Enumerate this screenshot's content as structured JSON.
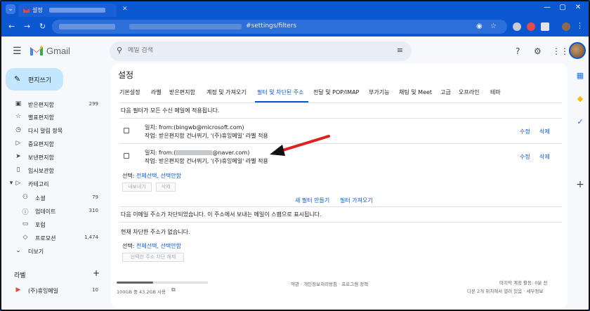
{
  "browser": {
    "tab_title": "설정",
    "url_visible": "#settings/filters"
  },
  "header": {
    "app_name": "Gmail",
    "search_placeholder": "메일 검색"
  },
  "sidebar": {
    "compose_label": "편지쓰기",
    "items": [
      {
        "label": "받은편지함",
        "count": "299",
        "icon": "inbox-icon"
      },
      {
        "label": "별표편지함",
        "count": "",
        "icon": "star-icon"
      },
      {
        "label": "다시 알림 항목",
        "count": "",
        "icon": "clock-icon"
      },
      {
        "label": "중요편지함",
        "count": "",
        "icon": "important-icon"
      },
      {
        "label": "보낸편지함",
        "count": "",
        "icon": "send-icon"
      },
      {
        "label": "임시보관함",
        "count": "",
        "icon": "draft-icon"
      },
      {
        "label": "카테고리",
        "count": "",
        "icon": "category-icon"
      }
    ],
    "categories": [
      {
        "label": "소셜",
        "count": "79",
        "icon": "people-icon"
      },
      {
        "label": "업데이트",
        "count": "310",
        "icon": "info-icon"
      },
      {
        "label": "포럼",
        "count": "",
        "icon": "forum-icon"
      },
      {
        "label": "프로모션",
        "count": "1,474",
        "icon": "tag-icon"
      }
    ],
    "more_label": "더보기",
    "labels_title": "라벨",
    "user_labels": [
      {
        "label": "(주)휴잉메일",
        "count": "10",
        "color": "#e8453c"
      }
    ]
  },
  "settings": {
    "title": "설정",
    "tabs": [
      "기본설정",
      "라벨",
      "받은편지함",
      "계정 및 가져오기",
      "필터 및 차단된 주소",
      "전달 및 POP/IMAP",
      "부가기능",
      "채팅 및 Meet",
      "고급",
      "오프라인",
      "테마"
    ],
    "active_tab": "필터 및 차단된 주소",
    "filters_heading": "다음 필터가 모든 수신 메일에 적용됩니다.",
    "filters": [
      {
        "match": "일치: from:(bingwb@microsoft.com)",
        "action": "작업: 받은편지함 건너뛰기, '(주)휴잉메일' 라벨 적용",
        "edit": "수정",
        "delete": "삭제"
      },
      {
        "match_prefix": "일치: from:(",
        "match_suffix": "@naver.com)",
        "action": "작업: 받은편지함 건너뛰기, '(주)휴잉메일' 라벨 적용",
        "edit": "수정",
        "delete": "삭제"
      }
    ],
    "select_label": "선택:",
    "select_all": "전체선택,",
    "select_none": "선택안함",
    "export_btn": "내보내기",
    "delete_btn": "삭제",
    "new_filter": "새 필터 만들기",
    "import_filter": "필터 가져오기",
    "blocked_heading": "다음 이메일 주소가 차단되었습니다. 이 주소에서 보내는 메일이 스팸으로 표시됩니다.",
    "blocked_empty": "현재 차단한 주소가 없습니다.",
    "unblock_btn": "선택한 주소 차단 해제"
  },
  "footer": {
    "storage": "100GB 중 43.2GB 사용",
    "links": "약관 · 개인정보처리방침 · 프로그램 정책",
    "last_activity": "마지막 계정 활동: 0분 전",
    "other_location": "다른 2개 위치에서 열려 있음 · 세부정보"
  },
  "colors": {
    "accent": "#0b57d0",
    "compose_bg": "#c2e7ff",
    "annotation_arrow": "#e02020"
  }
}
